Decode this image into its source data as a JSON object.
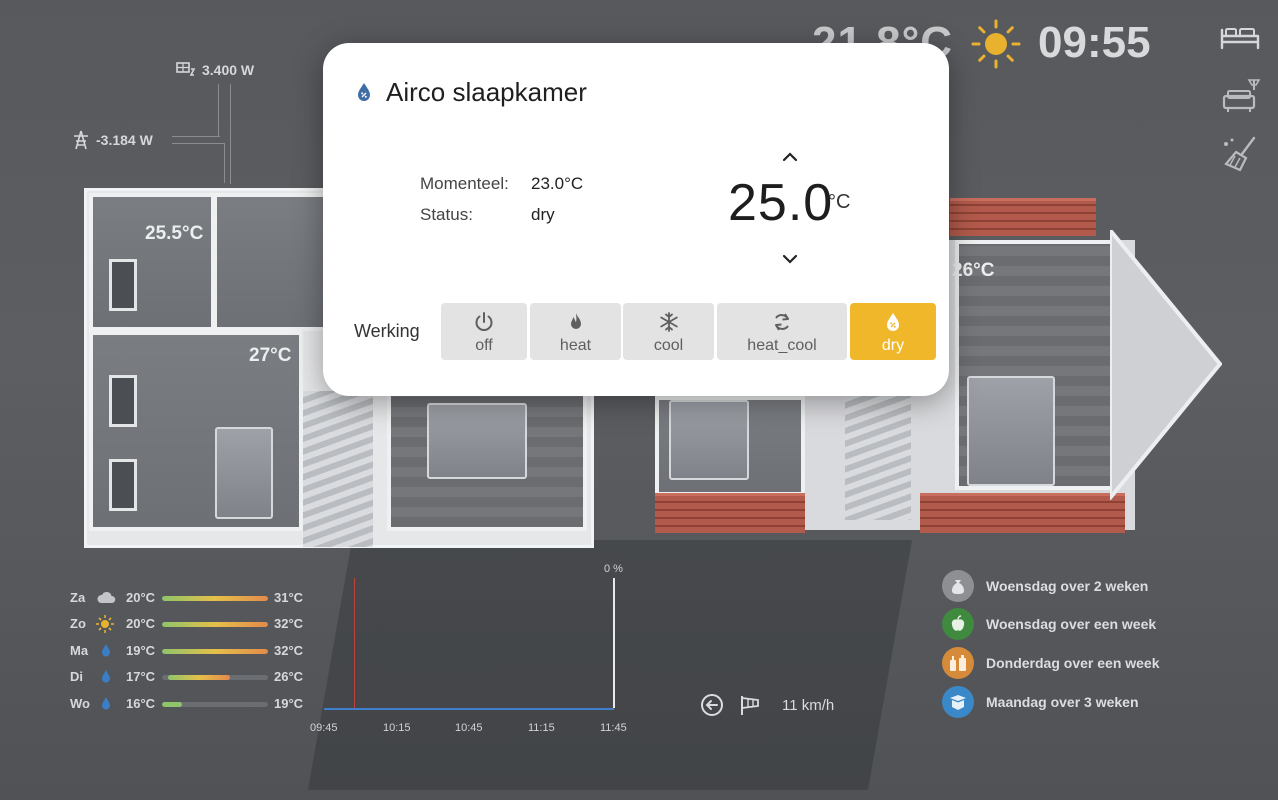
{
  "header": {
    "outdoor_temp": "21.8°C",
    "clock": "09:55",
    "weather_icon": "sun-icon"
  },
  "side_nav": [
    {
      "icon": "bed-icon"
    },
    {
      "icon": "living-room-icon"
    },
    {
      "icon": "cleaning-icon"
    }
  ],
  "power": {
    "solar": "3.400 W",
    "grid": "-3.184 W"
  },
  "rooms": {
    "room_1": "25.5°C",
    "room_2": "27°C",
    "room_3": "26°C"
  },
  "dialog": {
    "title": "Airco slaapkamer",
    "current_label": "Momenteel:",
    "current_value": "23.0°C",
    "status_label": "Status:",
    "status_value": "dry",
    "setpoint": "25.0",
    "setpoint_unit": "°C",
    "mode_label": "Werking",
    "modes": [
      {
        "label": "off",
        "icon": "power-icon"
      },
      {
        "label": "heat",
        "icon": "flame-icon"
      },
      {
        "label": "cool",
        "icon": "snowflake-icon"
      },
      {
        "label": "heat_cool",
        "icon": "sync-icon"
      },
      {
        "label": "dry",
        "icon": "water-drop-icon"
      }
    ],
    "active_mode": "dry",
    "accent_color": "#f0b72a"
  },
  "forecast": [
    {
      "day": "Za",
      "icon": "cloud-icon",
      "low": "20°C",
      "high": "31°C"
    },
    {
      "day": "Zo",
      "icon": "sun-icon",
      "low": "20°C",
      "high": "32°C"
    },
    {
      "day": "Ma",
      "icon": "rain-drop-icon",
      "low": "19°C",
      "high": "32°C"
    },
    {
      "day": "Di",
      "icon": "rain-drop-icon",
      "low": "17°C",
      "high": "26°C"
    },
    {
      "day": "Wo",
      "icon": "rain-drop-icon",
      "low": "16°C",
      "high": "19°C"
    }
  ],
  "graph": {
    "y_label": "0 %",
    "x_ticks": [
      "09:45",
      "10:15",
      "10:45",
      "11:15",
      "11:45"
    ]
  },
  "wind": {
    "speed": "11 km/h"
  },
  "waste": [
    {
      "text": "Woensdag over 2 weken",
      "color": "#8e8f93",
      "icon": "bag-icon"
    },
    {
      "text": "Woensdag over een week",
      "color": "#3f8a3e",
      "icon": "apple-icon"
    },
    {
      "text": "Donderdag over een week",
      "color": "#d58b3a",
      "icon": "bottles-icon"
    },
    {
      "text": "Maandag over 3 weken",
      "color": "#3a88c7",
      "icon": "box-icon"
    }
  ]
}
